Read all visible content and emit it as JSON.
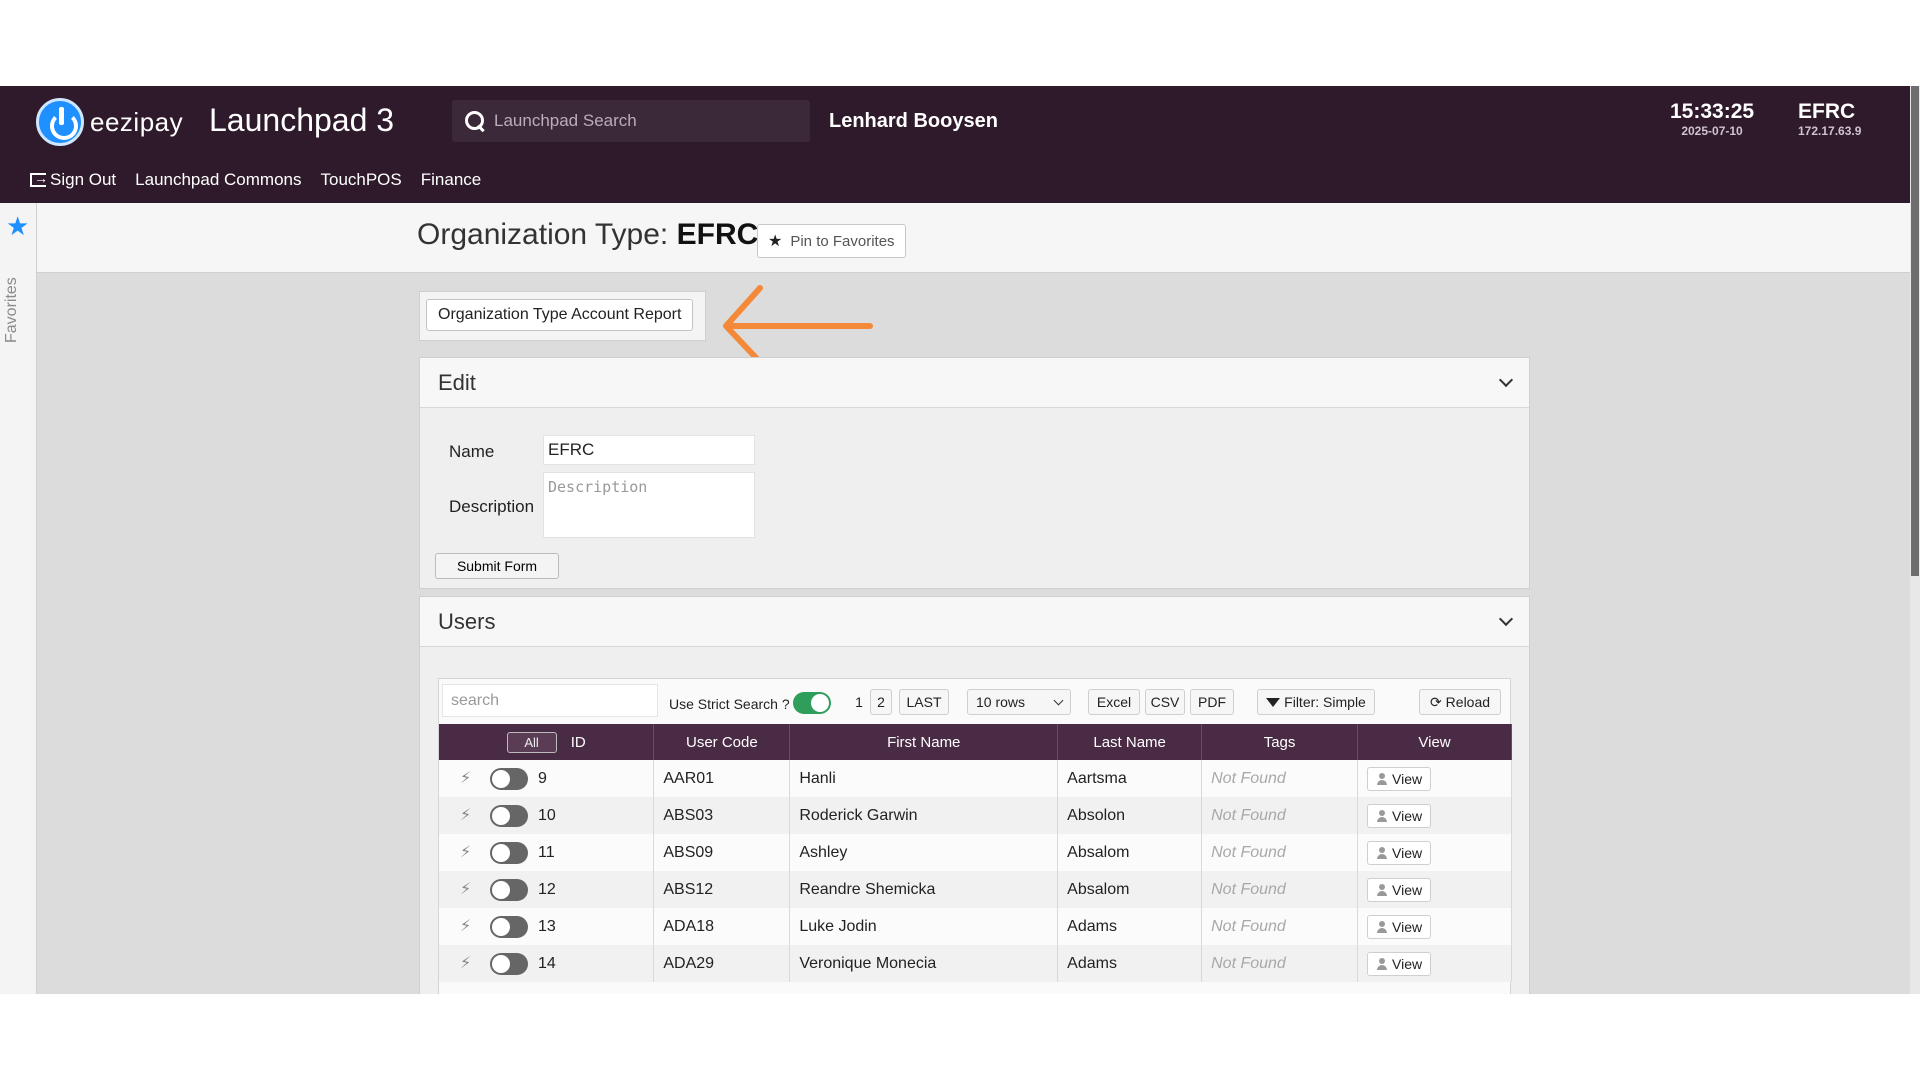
{
  "header": {
    "brand": "eezipay",
    "app_title": "Launchpad 3",
    "search_placeholder": "Launchpad Search",
    "user_name": "Lenhard Booysen",
    "time": "15:33:25",
    "date": "2025-07-10",
    "org_code": "EFRC",
    "ip": "172.17.63.9",
    "nav": {
      "sign_out": "Sign Out",
      "launchpad_commons": "Launchpad Commons",
      "touchpos": "TouchPOS",
      "finance": "Finance"
    }
  },
  "sidebar": {
    "favorites_label": "Favorites"
  },
  "page": {
    "title_prefix": "Organization Type:",
    "title_value": "EFRC",
    "pin_label": "Pin to Favorites",
    "report_button": "Organization Type Account Report"
  },
  "edit_panel": {
    "title": "Edit",
    "name_label": "Name",
    "name_value": "EFRC",
    "description_label": "Description",
    "description_placeholder": "Description",
    "submit_label": "Submit Form"
  },
  "users_panel": {
    "title": "Users",
    "search_placeholder": "search",
    "strict_search_label": "Use Strict Search ?",
    "pages": [
      "1",
      "2"
    ],
    "last_label": "LAST",
    "rows_label": "10 rows",
    "excel_label": "Excel",
    "csv_label": "CSV",
    "pdf_label": "PDF",
    "filter_label": "Filter: Simple",
    "reload_label": "Reload",
    "columns": {
      "all": "All",
      "id": "ID",
      "user_code": "User Code",
      "first_name": "First Name",
      "last_name": "Last Name",
      "tags": "Tags",
      "view": "View"
    },
    "rows": [
      {
        "id": "9",
        "user_code": "AAR01",
        "first_name": "Hanli",
        "last_name": "Aartsma",
        "tags": "Not Found",
        "view": "View"
      },
      {
        "id": "10",
        "user_code": "ABS03",
        "first_name": "Roderick Garwin",
        "last_name": "Absolon",
        "tags": "Not Found",
        "view": "View"
      },
      {
        "id": "11",
        "user_code": "ABS09",
        "first_name": "Ashley",
        "last_name": "Absalom",
        "tags": "Not Found",
        "view": "View"
      },
      {
        "id": "12",
        "user_code": "ABS12",
        "first_name": "Reandre Shemicka",
        "last_name": "Absalom",
        "tags": "Not Found",
        "view": "View"
      },
      {
        "id": "13",
        "user_code": "ADA18",
        "first_name": "Luke Jodin",
        "last_name": "Adams",
        "tags": "Not Found",
        "view": "View"
      },
      {
        "id": "14",
        "user_code": "ADA29",
        "first_name": "Veronique Monecia",
        "last_name": "Adams",
        "tags": "Not Found",
        "view": "View"
      }
    ]
  },
  "colors": {
    "header_bg": "#2e1a2b",
    "table_header_bg": "#4a2b45",
    "accent_blue": "#1e90ff",
    "toggle_green": "#2e9e5a",
    "annotation_arrow": "#f5893a"
  }
}
